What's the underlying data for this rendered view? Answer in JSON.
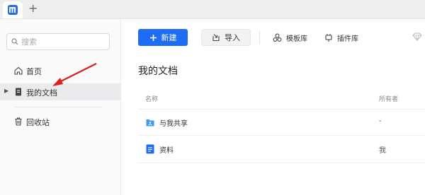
{
  "tabbar": {
    "app_icon": "app-logo-icon",
    "new_tab": "+"
  },
  "sidebar": {
    "search_placeholder": "搜索",
    "items": [
      {
        "label": "首页",
        "icon": "home-icon"
      },
      {
        "label": "我的文档",
        "icon": "document-icon",
        "active": true
      },
      {
        "label": "回收站",
        "icon": "trash-icon"
      }
    ]
  },
  "toolbar": {
    "new_label": "新建",
    "import_label": "导入",
    "templates_label": "模板库",
    "plugins_label": "插件库"
  },
  "main": {
    "title": "我的文档",
    "columns": [
      "名称",
      "所有者"
    ],
    "rows": [
      {
        "name": "与我共享",
        "owner": "-",
        "icon": "shared-folder-icon"
      },
      {
        "name": "资料",
        "owner": "我",
        "icon": "doc-file-icon"
      }
    ]
  },
  "colors": {
    "accent": "#1e6cf3",
    "annotation_arrow": "#d9221c"
  }
}
